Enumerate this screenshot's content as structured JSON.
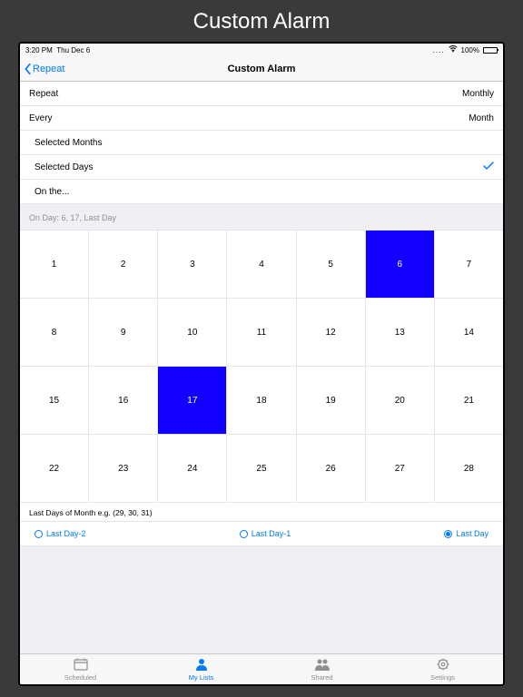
{
  "outerTitle": "Custom Alarm",
  "statusBar": {
    "time": "3:20 PM",
    "date": "Thu Dec 6",
    "batteryPct": "100%"
  },
  "nav": {
    "back": "Repeat",
    "title": "Custom Alarm"
  },
  "rows": {
    "repeat": {
      "label": "Repeat",
      "value": "Monthly"
    },
    "every": {
      "label": "Every",
      "value": "Month"
    },
    "selectedMonths": {
      "label": "Selected Months"
    },
    "selectedDays": {
      "label": "Selected Days",
      "checked": true
    },
    "onThe": {
      "label": "On the..."
    }
  },
  "summary": "On Day: 6, 17, Last Day",
  "calendar": {
    "days": [
      1,
      2,
      3,
      4,
      5,
      6,
      7,
      8,
      9,
      10,
      11,
      12,
      13,
      14,
      15,
      16,
      17,
      18,
      19,
      20,
      21,
      22,
      23,
      24,
      25,
      26,
      27,
      28
    ],
    "selected": [
      6,
      17
    ]
  },
  "lastDays": {
    "label": "Last Days of Month e.g. (29, 30, 31)",
    "options": [
      {
        "label": "Last Day-2",
        "selected": false
      },
      {
        "label": "Last Day-1",
        "selected": false
      },
      {
        "label": "Last Day",
        "selected": true
      }
    ]
  },
  "tabs": [
    {
      "label": "Scheduled",
      "icon": "calendar",
      "active": false
    },
    {
      "label": "My Lists",
      "icon": "person",
      "active": true
    },
    {
      "label": "Shared",
      "icon": "people",
      "active": false
    },
    {
      "label": "Settings",
      "icon": "gear",
      "active": false
    }
  ]
}
